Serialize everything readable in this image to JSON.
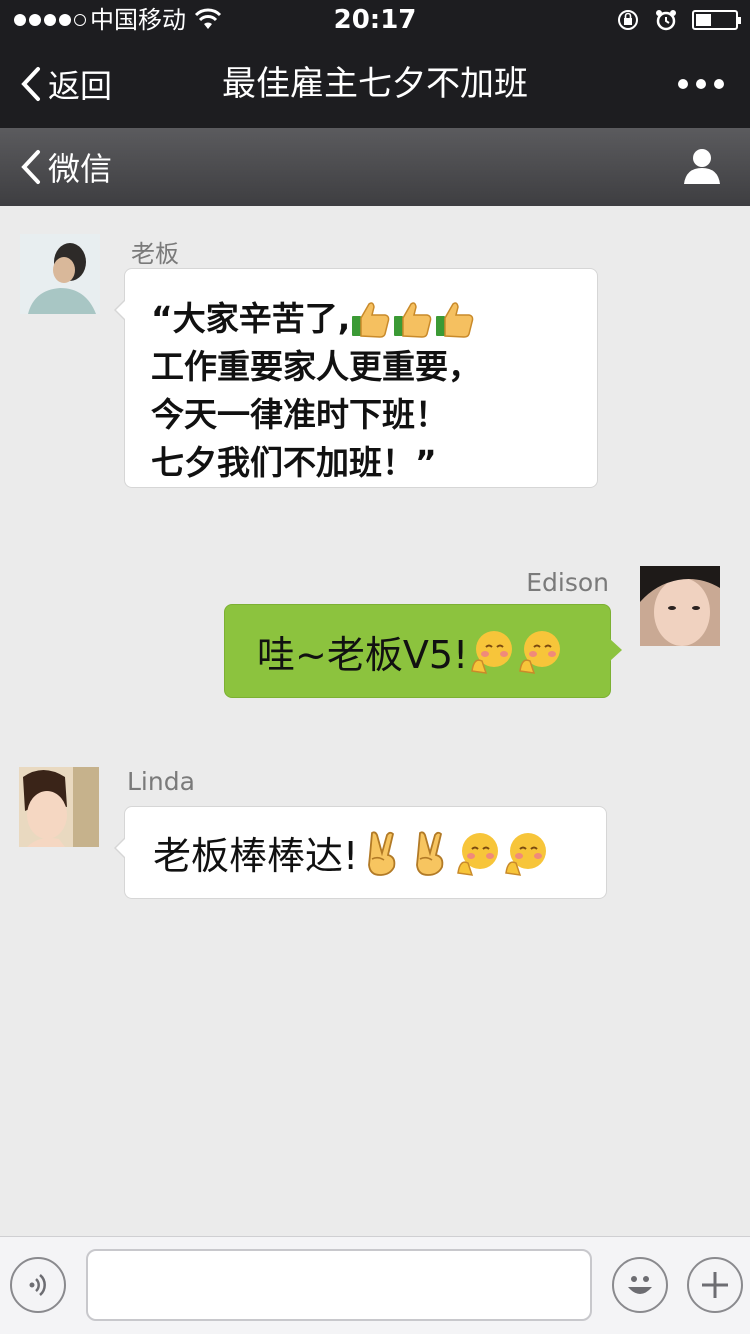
{
  "status_bar": {
    "carrier": "中国移动",
    "time": "20:17",
    "signal_bars": 4,
    "battery_level": 0.4
  },
  "nav": {
    "back_label": "返回",
    "title": "最佳雇主七夕不加班",
    "more_icon": "more-dots-icon"
  },
  "sub_nav": {
    "back_label": "微信",
    "profile_icon": "user-profile-icon"
  },
  "messages": [
    {
      "sender": "老板",
      "side": "left",
      "lines": [
        "“大家辛苦了,",
        "工作重要家人更重要，",
        "今天一律准时下班！",
        "七夕我们不加班！”"
      ],
      "emojis": [
        "thumbs-up-icon",
        "thumbs-up-icon",
        "thumbs-up-icon"
      ]
    },
    {
      "sender": "Edison",
      "side": "right",
      "text": "哇~老板V5!",
      "emojis": [
        "hug-face-icon",
        "hug-face-icon"
      ]
    },
    {
      "sender": "Linda",
      "side": "left",
      "text": "老板棒棒达!",
      "emojis": [
        "victory-hand-icon",
        "victory-hand-icon",
        "hug-face-icon",
        "hug-face-icon"
      ]
    }
  ],
  "input_bar": {
    "voice_icon": "voice-icon",
    "input_value": "",
    "emoji_icon": "emoji-face-icon",
    "plus_icon": "plus-icon"
  },
  "colors": {
    "nav_background": "#1d1d20",
    "chat_background": "#ebebeb",
    "self_bubble": "#8cc33e",
    "other_bubble": "#ffffff"
  }
}
